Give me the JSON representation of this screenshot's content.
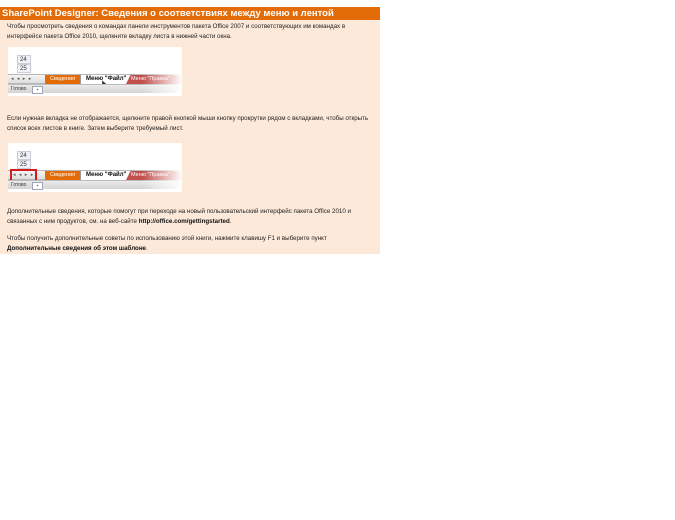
{
  "title": "SharePoint Designer: Сведения о соответствиях между меню и лентой",
  "paragraph1": "Чтобы просмотреть сведения о командах панели инструментов пакета Office 2007 и соответствующих им командах в интерфейсе пакета Office 2010, щелкните вкладку листа в нижней части окна.",
  "paragraph2": "Если нужная вкладка не отображается, щелкните правой кнопкой мыши кнопку прокрутки рядом с вкладками, чтобы открыть список всех листов в книге. Затем выберите требуемый лист.",
  "paragraph3_text": "Дополнительные сведения, которые помогут при переходе на новый пользовательский интерфейс пакета Office 2010 и связанных с ним продуктов, см. на веб-сайте ",
  "paragraph3_link": "http://office.com/gettingstarted",
  "paragraph3_end": ".",
  "paragraph4_text": "Чтобы получить дополнительные советы по использованию этой книги, нажмите клавишу F1 и выберите пункт ",
  "paragraph4_bold": "Дополнительные сведения об этом шаблоне",
  "paragraph4_end": ".",
  "screenshot1": {
    "row_a": "24",
    "row_b": "25",
    "nav": "◂ ◂ ▸ ▸",
    "tab_left": "Сведения",
    "tab_active": "Меню \"Файл\"",
    "tab_right": "Меню \"Правка\"",
    "status": "Готово"
  },
  "screenshot2": {
    "row_a": "24",
    "row_b": "25",
    "nav": "◂ ◂ ▸ ▸",
    "tab_left": "Сведения",
    "tab_active": "Меню \"Файл\"",
    "tab_right": "Меню \"Правка\"",
    "status": "Готово"
  },
  "colors": {
    "title_bg": "#e36c09",
    "sheet_bg": "#fde9d9",
    "highlight": "#d11c1c"
  }
}
